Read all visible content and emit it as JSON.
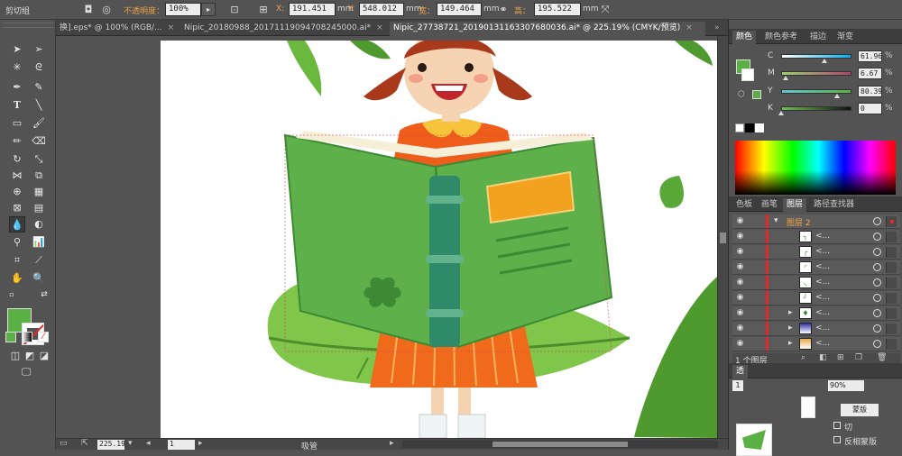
{
  "control_bar": {
    "group_label": "剪切组",
    "opacity_label": "不透明度：",
    "opacity_value": "100%",
    "x_label": "X:",
    "x_value": "191.451",
    "y_label": "Y:",
    "y_value": "548.012",
    "w_label": "宽：",
    "w_value": "149.464",
    "h_label": "高：",
    "h_value": "195.522",
    "unit": "mm"
  },
  "doc_tabs": [
    {
      "label": "换].eps* @ 100% (RGB/..."
    },
    {
      "label": "Nipic_20180988_20171119094708245000.ai*"
    },
    {
      "label": "Nipic_27738721_20190131163307680036.ai* @ 225.19% (CMYK/预览)"
    }
  ],
  "color_panel": {
    "tabs": [
      "颜色",
      "颜色参考",
      "描边",
      "渐变"
    ],
    "channels": [
      {
        "name": "C",
        "value": "61.96",
        "fraction": 0.62,
        "track": "linear-gradient(to right,#fff,#00aeef)"
      },
      {
        "name": "M",
        "value": "6.67",
        "fraction": 0.07,
        "track": "linear-gradient(to right,#9fd36f,#b0446c)"
      },
      {
        "name": "Y",
        "value": "80.39",
        "fraction": 0.8,
        "track": "linear-gradient(to right,#66c5d6,#5ab044)"
      },
      {
        "name": "K",
        "value": "0",
        "fraction": 0.0,
        "track": "linear-gradient(to right,#6fc053,#111)"
      }
    ],
    "pct": "%",
    "fill_color": "#5ab044"
  },
  "layers_panel": {
    "tabs": [
      "色板",
      "画笔",
      "图层",
      "路径查找器"
    ],
    "parent_layer": "图层 2",
    "rows": [
      "<...",
      "<...",
      "<...",
      "<...",
      "<...",
      "<...",
      "<...",
      "<..."
    ],
    "footer_count": "1 个图层"
  },
  "transparency_panel": {
    "tab": "透",
    "opacity": "90%",
    "make_mask": "蒙版",
    "clip": "切",
    "invert_mask": "反相蒙版"
  },
  "status_bar": {
    "zoom": "225.19",
    "page": "1",
    "tool": "吸管"
  }
}
